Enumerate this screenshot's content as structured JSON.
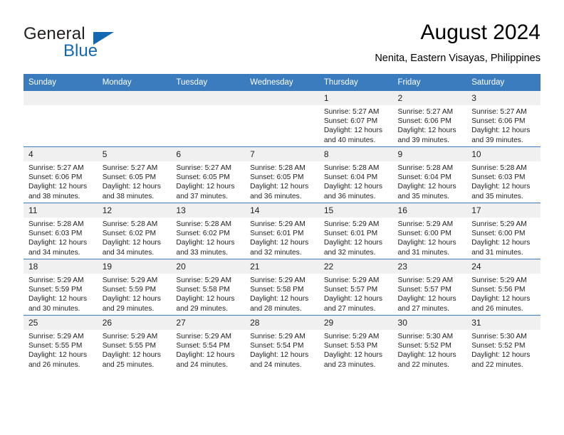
{
  "logo": {
    "text_primary": "General",
    "text_secondary": "Blue",
    "color_primary": "#231f20",
    "color_secondary": "#1268b3"
  },
  "header": {
    "title": "August 2024",
    "subtitle": "Nenita, Eastern Visayas, Philippines"
  },
  "theme": {
    "header_bg": "#3a7cbe",
    "header_text": "#ffffff",
    "daynum_bg": "#f0f0f0",
    "cell_text": "#222222",
    "grid_line": "#3a7cbe"
  },
  "weekdays": [
    "Sunday",
    "Monday",
    "Tuesday",
    "Wednesday",
    "Thursday",
    "Friday",
    "Saturday"
  ],
  "weeks": [
    [
      {
        "empty": true,
        "day": ""
      },
      {
        "empty": true,
        "day": ""
      },
      {
        "empty": true,
        "day": ""
      },
      {
        "empty": true,
        "day": ""
      },
      {
        "empty": false,
        "day": "1",
        "sunrise": "Sunrise: 5:27 AM",
        "sunset": "Sunset: 6:07 PM",
        "daylight1": "Daylight: 12 hours",
        "daylight2": "and 40 minutes."
      },
      {
        "empty": false,
        "day": "2",
        "sunrise": "Sunrise: 5:27 AM",
        "sunset": "Sunset: 6:06 PM",
        "daylight1": "Daylight: 12 hours",
        "daylight2": "and 39 minutes."
      },
      {
        "empty": false,
        "day": "3",
        "sunrise": "Sunrise: 5:27 AM",
        "sunset": "Sunset: 6:06 PM",
        "daylight1": "Daylight: 12 hours",
        "daylight2": "and 39 minutes."
      }
    ],
    [
      {
        "empty": false,
        "day": "4",
        "sunrise": "Sunrise: 5:27 AM",
        "sunset": "Sunset: 6:06 PM",
        "daylight1": "Daylight: 12 hours",
        "daylight2": "and 38 minutes."
      },
      {
        "empty": false,
        "day": "5",
        "sunrise": "Sunrise: 5:27 AM",
        "sunset": "Sunset: 6:05 PM",
        "daylight1": "Daylight: 12 hours",
        "daylight2": "and 38 minutes."
      },
      {
        "empty": false,
        "day": "6",
        "sunrise": "Sunrise: 5:27 AM",
        "sunset": "Sunset: 6:05 PM",
        "daylight1": "Daylight: 12 hours",
        "daylight2": "and 37 minutes."
      },
      {
        "empty": false,
        "day": "7",
        "sunrise": "Sunrise: 5:28 AM",
        "sunset": "Sunset: 6:05 PM",
        "daylight1": "Daylight: 12 hours",
        "daylight2": "and 36 minutes."
      },
      {
        "empty": false,
        "day": "8",
        "sunrise": "Sunrise: 5:28 AM",
        "sunset": "Sunset: 6:04 PM",
        "daylight1": "Daylight: 12 hours",
        "daylight2": "and 36 minutes."
      },
      {
        "empty": false,
        "day": "9",
        "sunrise": "Sunrise: 5:28 AM",
        "sunset": "Sunset: 6:04 PM",
        "daylight1": "Daylight: 12 hours",
        "daylight2": "and 35 minutes."
      },
      {
        "empty": false,
        "day": "10",
        "sunrise": "Sunrise: 5:28 AM",
        "sunset": "Sunset: 6:03 PM",
        "daylight1": "Daylight: 12 hours",
        "daylight2": "and 35 minutes."
      }
    ],
    [
      {
        "empty": false,
        "day": "11",
        "sunrise": "Sunrise: 5:28 AM",
        "sunset": "Sunset: 6:03 PM",
        "daylight1": "Daylight: 12 hours",
        "daylight2": "and 34 minutes."
      },
      {
        "empty": false,
        "day": "12",
        "sunrise": "Sunrise: 5:28 AM",
        "sunset": "Sunset: 6:02 PM",
        "daylight1": "Daylight: 12 hours",
        "daylight2": "and 34 minutes."
      },
      {
        "empty": false,
        "day": "13",
        "sunrise": "Sunrise: 5:28 AM",
        "sunset": "Sunset: 6:02 PM",
        "daylight1": "Daylight: 12 hours",
        "daylight2": "and 33 minutes."
      },
      {
        "empty": false,
        "day": "14",
        "sunrise": "Sunrise: 5:29 AM",
        "sunset": "Sunset: 6:01 PM",
        "daylight1": "Daylight: 12 hours",
        "daylight2": "and 32 minutes."
      },
      {
        "empty": false,
        "day": "15",
        "sunrise": "Sunrise: 5:29 AM",
        "sunset": "Sunset: 6:01 PM",
        "daylight1": "Daylight: 12 hours",
        "daylight2": "and 32 minutes."
      },
      {
        "empty": false,
        "day": "16",
        "sunrise": "Sunrise: 5:29 AM",
        "sunset": "Sunset: 6:00 PM",
        "daylight1": "Daylight: 12 hours",
        "daylight2": "and 31 minutes."
      },
      {
        "empty": false,
        "day": "17",
        "sunrise": "Sunrise: 5:29 AM",
        "sunset": "Sunset: 6:00 PM",
        "daylight1": "Daylight: 12 hours",
        "daylight2": "and 31 minutes."
      }
    ],
    [
      {
        "empty": false,
        "day": "18",
        "sunrise": "Sunrise: 5:29 AM",
        "sunset": "Sunset: 5:59 PM",
        "daylight1": "Daylight: 12 hours",
        "daylight2": "and 30 minutes."
      },
      {
        "empty": false,
        "day": "19",
        "sunrise": "Sunrise: 5:29 AM",
        "sunset": "Sunset: 5:59 PM",
        "daylight1": "Daylight: 12 hours",
        "daylight2": "and 29 minutes."
      },
      {
        "empty": false,
        "day": "20",
        "sunrise": "Sunrise: 5:29 AM",
        "sunset": "Sunset: 5:58 PM",
        "daylight1": "Daylight: 12 hours",
        "daylight2": "and 29 minutes."
      },
      {
        "empty": false,
        "day": "21",
        "sunrise": "Sunrise: 5:29 AM",
        "sunset": "Sunset: 5:58 PM",
        "daylight1": "Daylight: 12 hours",
        "daylight2": "and 28 minutes."
      },
      {
        "empty": false,
        "day": "22",
        "sunrise": "Sunrise: 5:29 AM",
        "sunset": "Sunset: 5:57 PM",
        "daylight1": "Daylight: 12 hours",
        "daylight2": "and 27 minutes."
      },
      {
        "empty": false,
        "day": "23",
        "sunrise": "Sunrise: 5:29 AM",
        "sunset": "Sunset: 5:57 PM",
        "daylight1": "Daylight: 12 hours",
        "daylight2": "and 27 minutes."
      },
      {
        "empty": false,
        "day": "24",
        "sunrise": "Sunrise: 5:29 AM",
        "sunset": "Sunset: 5:56 PM",
        "daylight1": "Daylight: 12 hours",
        "daylight2": "and 26 minutes."
      }
    ],
    [
      {
        "empty": false,
        "day": "25",
        "sunrise": "Sunrise: 5:29 AM",
        "sunset": "Sunset: 5:55 PM",
        "daylight1": "Daylight: 12 hours",
        "daylight2": "and 26 minutes."
      },
      {
        "empty": false,
        "day": "26",
        "sunrise": "Sunrise: 5:29 AM",
        "sunset": "Sunset: 5:55 PM",
        "daylight1": "Daylight: 12 hours",
        "daylight2": "and 25 minutes."
      },
      {
        "empty": false,
        "day": "27",
        "sunrise": "Sunrise: 5:29 AM",
        "sunset": "Sunset: 5:54 PM",
        "daylight1": "Daylight: 12 hours",
        "daylight2": "and 24 minutes."
      },
      {
        "empty": false,
        "day": "28",
        "sunrise": "Sunrise: 5:29 AM",
        "sunset": "Sunset: 5:54 PM",
        "daylight1": "Daylight: 12 hours",
        "daylight2": "and 24 minutes."
      },
      {
        "empty": false,
        "day": "29",
        "sunrise": "Sunrise: 5:29 AM",
        "sunset": "Sunset: 5:53 PM",
        "daylight1": "Daylight: 12 hours",
        "daylight2": "and 23 minutes."
      },
      {
        "empty": false,
        "day": "30",
        "sunrise": "Sunrise: 5:30 AM",
        "sunset": "Sunset: 5:52 PM",
        "daylight1": "Daylight: 12 hours",
        "daylight2": "and 22 minutes."
      },
      {
        "empty": false,
        "day": "31",
        "sunrise": "Sunrise: 5:30 AM",
        "sunset": "Sunset: 5:52 PM",
        "daylight1": "Daylight: 12 hours",
        "daylight2": "and 22 minutes."
      }
    ]
  ]
}
